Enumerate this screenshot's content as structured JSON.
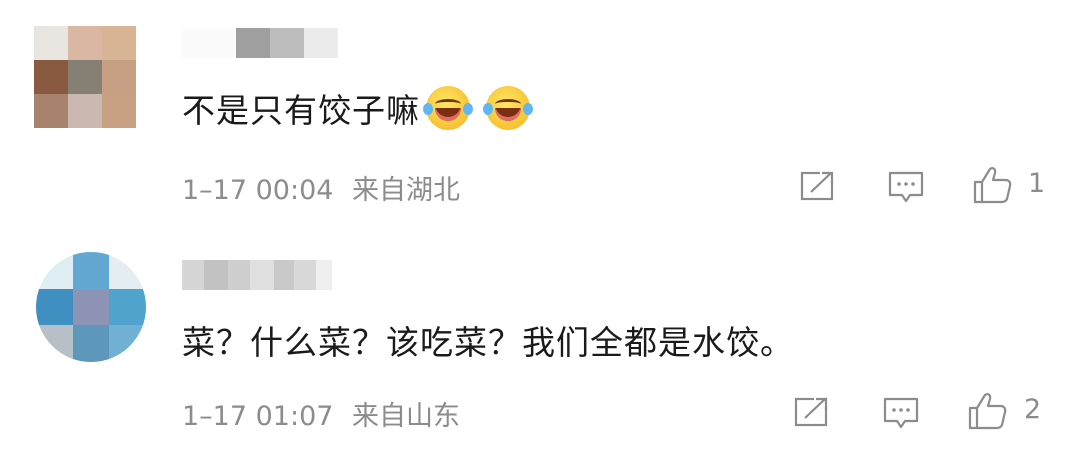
{
  "comments": [
    {
      "username": "",
      "text": "不是只有饺子嘛",
      "emojis": [
        "laughing-tears-emoji",
        "laughing-tears-emoji"
      ],
      "time": "1–17 00:04",
      "location": "来自湖北",
      "likes": "1"
    },
    {
      "username": "",
      "text": "菜？什么菜？该吃菜？我们全都是水饺。",
      "emojis": [],
      "time": "1–17 01:07",
      "location": "来自山东",
      "likes": "2"
    }
  ],
  "icons": {
    "share": "share-icon",
    "reply": "reply-icon",
    "like": "thumbs-up-icon"
  },
  "colors": {
    "text": "#1a1a1a",
    "meta": "#8c8c8c",
    "background": "#ffffff"
  }
}
